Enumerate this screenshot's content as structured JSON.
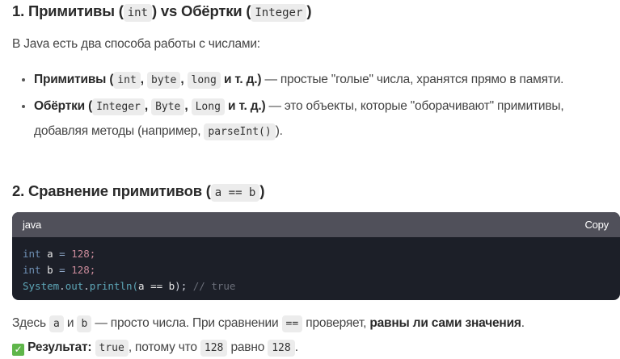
{
  "h1": {
    "prefix": "1. Примитивы (",
    "code1": "int",
    "mid": ") vs Обёртки (",
    "code2": "Integer",
    "suffix": ")"
  },
  "intro": "В Java есть два способа работы с числами:",
  "bullets": [
    {
      "title": "Примитивы (",
      "codes": [
        "int",
        "byte",
        "long"
      ],
      "etc": "и т. д.)",
      "text": " — простые \"голые\" числа, хранятся прямо в памяти."
    },
    {
      "title": "Обёртки (",
      "codes": [
        "Integer",
        "Byte",
        "Long"
      ],
      "etc": "и т. д.)",
      "text": " — это объекты, которые \"оборачивают\" примитивы, добавляя методы (например, ",
      "code_extra": "parseInt()",
      "end": ")."
    }
  ],
  "h2": {
    "prefix": "2. Сравнение примитивов (",
    "code": "a == b",
    "suffix": ")"
  },
  "codeblock": {
    "lang": "java",
    "copy": "Copy",
    "lines": [
      {
        "kw": "int",
        "var": "a",
        "op": "=",
        "num": "128;"
      },
      {
        "kw": "int",
        "var": "b",
        "op": "=",
        "num": "128;"
      },
      {
        "cls": "System",
        "dot1": ".",
        "field": "out",
        "dot2": ".",
        "method": "println(",
        "args": "a == b",
        "close": ");",
        "comment": "// true"
      }
    ]
  },
  "para": {
    "t1": "Здесь ",
    "a": "a",
    "t2": " и ",
    "b": "b",
    "t3": " — просто числа. При сравнении ",
    "eq": "==",
    "t4": " проверяет, ",
    "bold": "равны ли сами значения",
    "t5": "."
  },
  "result": {
    "icon": "✓",
    "label": "Результат:",
    "val": "true",
    "t1": ", потому что ",
    "n1": "128",
    "t2": " равно ",
    "n2": "128",
    "t3": "."
  }
}
